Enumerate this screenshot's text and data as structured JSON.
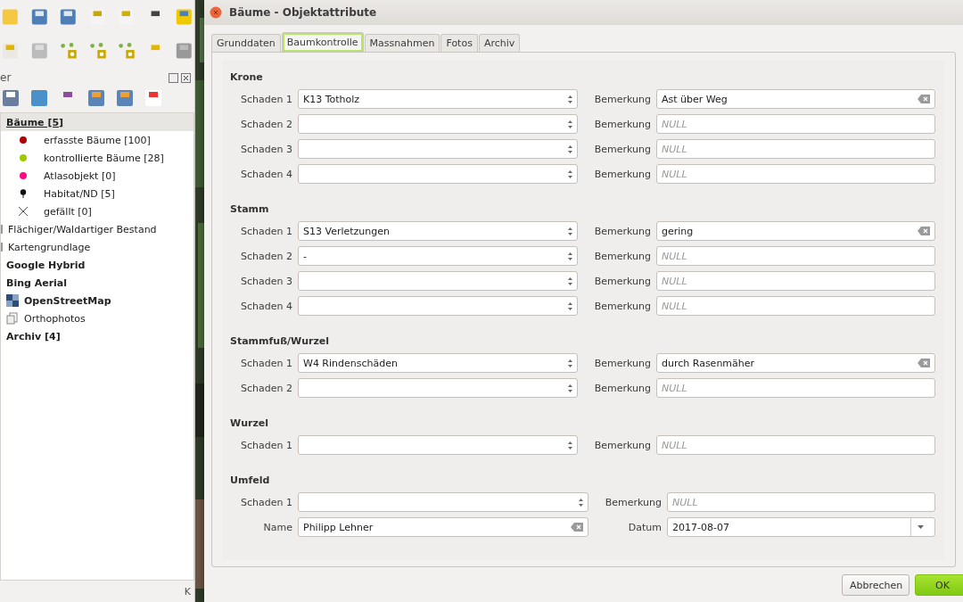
{
  "panel": {
    "title": "er"
  },
  "layers": [
    {
      "label": "Bäume [5]",
      "kind": "group",
      "bold": true,
      "selected": true,
      "children": [
        {
          "label": "erfasste Bäume [100]",
          "kind": "dot",
          "color": "#b00000",
          "selected": false
        },
        {
          "label": "kontrollierte Bäume [28]",
          "kind": "dot",
          "color": "#9ccc00",
          "selected": false
        },
        {
          "label": "Atlasobjekt [0]",
          "kind": "dot",
          "color": "#ff0a80",
          "selected": false
        },
        {
          "label": "Habitat/ND [5]",
          "kind": "pin",
          "selected": false
        },
        {
          "label": "gefällt [0]",
          "kind": "cross",
          "selected": false
        }
      ]
    },
    {
      "label": "Flächiger/Waldartiger Bestand",
      "kind": "group",
      "bold": false,
      "selected": false
    },
    {
      "label": "Kartengrundlage",
      "kind": "group",
      "bold": false,
      "selected": false
    },
    {
      "label": "Google Hybrid",
      "kind": "plain",
      "bold": true,
      "selected": false
    },
    {
      "label": "Bing Aerial",
      "kind": "plain",
      "bold": true,
      "selected": false
    },
    {
      "label": "OpenStreetMap",
      "kind": "tiles",
      "bold": true,
      "selected": false
    },
    {
      "label": "Orthophotos",
      "kind": "stack",
      "bold": false,
      "selected": false
    },
    {
      "label": "Archiv [4]",
      "kind": "plain",
      "bold": true,
      "selected": false
    }
  ],
  "status_bar": {
    "text": "K"
  },
  "dialog": {
    "title": "Bäume - Objektattribute",
    "tabs": [
      {
        "label": "Grunddaten",
        "selected": false
      },
      {
        "label": "Baumkontrolle",
        "selected": true
      },
      {
        "label": "Massnahmen",
        "selected": false
      },
      {
        "label": "Fotos",
        "selected": false
      },
      {
        "label": "Archiv",
        "selected": false
      }
    ],
    "groups": [
      {
        "title": "Krone",
        "rows": [
          {
            "kind": "damage",
            "label": "Schaden 1",
            "value": "K13 Totholz",
            "remark_label": "Bemerkung",
            "remark": "Ast über Weg"
          },
          {
            "kind": "damage",
            "label": "Schaden 2",
            "remark_label": "Bemerkung",
            "remark_placeholder": "NULL"
          },
          {
            "kind": "damage",
            "label": "Schaden 3",
            "remark_label": "Bemerkung",
            "remark_placeholder": "NULL"
          },
          {
            "kind": "damage",
            "label": "Schaden 4",
            "remark_label": "Bemerkung",
            "remark_placeholder": "NULL"
          }
        ]
      },
      {
        "title": "Stamm",
        "rows": [
          {
            "kind": "damage",
            "label": "Schaden 1",
            "value": "S13 Verletzungen",
            "remark_label": "Bemerkung",
            "remark": "gering"
          },
          {
            "kind": "damage",
            "label": "Schaden 2",
            "value": "-",
            "remark_label": "Bemerkung",
            "remark_placeholder": "NULL"
          },
          {
            "kind": "damage",
            "label": "Schaden 3",
            "remark_label": "Bemerkung",
            "remark_placeholder": "NULL"
          },
          {
            "kind": "damage",
            "label": "Schaden 4",
            "remark_label": "Bemerkung",
            "remark_placeholder": "NULL"
          }
        ]
      },
      {
        "title": "Stammfuß/Wurzel",
        "rows": [
          {
            "kind": "damage",
            "label": "Schaden 1",
            "value": "W4 Rindenschäden",
            "remark_label": "Bemerkung",
            "remark": "durch Rasenmäher"
          },
          {
            "kind": "damage",
            "label": "Schaden 2",
            "remark_label": "Bemerkung",
            "remark_placeholder": "NULL"
          }
        ]
      },
      {
        "title": "Wurzel",
        "rows": [
          {
            "kind": "damage",
            "label": "Schaden 1",
            "remark_label": "Bemerkung",
            "remark_placeholder": "NULL"
          }
        ]
      },
      {
        "title": "Umfeld",
        "rows": [
          {
            "kind": "damage",
            "label": "Schaden 1",
            "remark_label": "Bemerkung",
            "remark_placeholder": "NULL"
          },
          {
            "kind": "name_date",
            "label": "Name",
            "value": "Philipp Lehner",
            "remark_label": "Datum",
            "remark": "2017-08-07"
          }
        ]
      }
    ],
    "buttons": [
      {
        "label": "Abbrechen",
        "kind": "secondary"
      },
      {
        "label": "OK",
        "kind": "primary"
      }
    ]
  }
}
